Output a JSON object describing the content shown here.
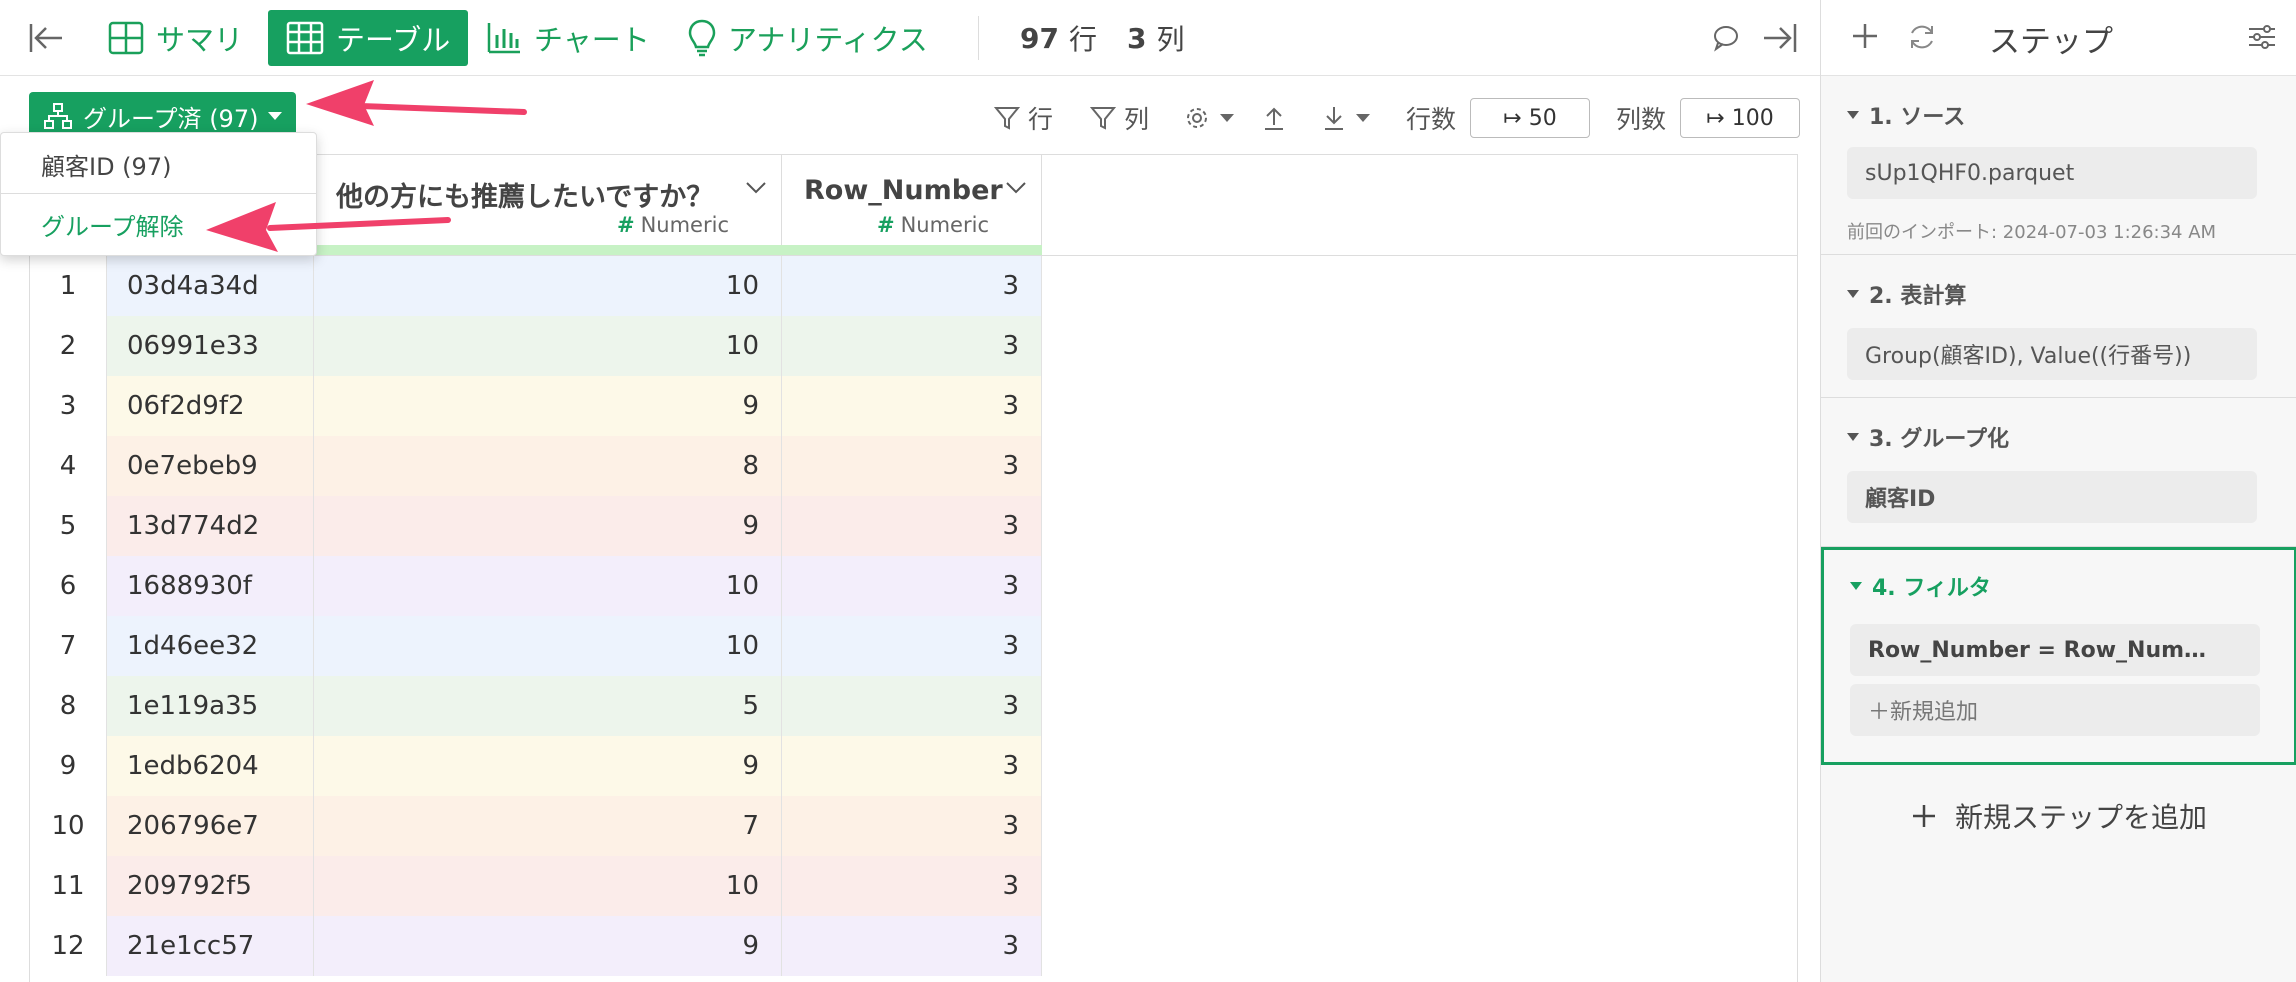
{
  "toolbar": {
    "tabs": [
      {
        "label": "サマリ",
        "icon": "summary-grid-icon"
      },
      {
        "label": "テーブル",
        "icon": "table-icon",
        "active": true
      },
      {
        "label": "チャート",
        "icon": "bar-chart-icon"
      },
      {
        "label": "アナリティクス",
        "icon": "lightbulb-icon"
      }
    ],
    "rows_count": "97",
    "rows_unit": "行",
    "cols_count": "3",
    "cols_unit": "列"
  },
  "subtoolbar": {
    "group_button": "グループ済 (97)",
    "filter_row": "行",
    "filter_col": "列",
    "rows_label": "行数",
    "rows_value": "↦ 50",
    "cols_label": "列数",
    "cols_value": "↦ 100"
  },
  "dropdown": {
    "items": [
      "顧客ID (97)",
      "グループ解除"
    ]
  },
  "columns": [
    {
      "title": "他の方にも推薦したいですか？",
      "type": "Numeric"
    },
    {
      "title": "Row_Number",
      "type": "Numeric"
    }
  ],
  "rows": [
    {
      "n": "1",
      "id": "03d4a34d",
      "rec": "10",
      "rn": "3",
      "color": "#edf3fd"
    },
    {
      "n": "2",
      "id": "06991e33",
      "rec": "10",
      "rn": "3",
      "color": "#edf5ec"
    },
    {
      "n": "3",
      "id": "06f2d9f2",
      "rec": "9",
      "rn": "3",
      "color": "#fdf9e8"
    },
    {
      "n": "4",
      "id": "0e7ebeb9",
      "rec": "8",
      "rn": "3",
      "color": "#fdf1e6"
    },
    {
      "n": "5",
      "id": "13d774d2",
      "rec": "9",
      "rn": "3",
      "color": "#fbecea"
    },
    {
      "n": "6",
      "id": "1688930f",
      "rec": "10",
      "rn": "3",
      "color": "#f3eefb"
    },
    {
      "n": "7",
      "id": "1d46ee32",
      "rec": "10",
      "rn": "3",
      "color": "#edf3fd"
    },
    {
      "n": "8",
      "id": "1e119a35",
      "rec": "5",
      "rn": "3",
      "color": "#edf5ec"
    },
    {
      "n": "9",
      "id": "1edb6204",
      "rec": "9",
      "rn": "3",
      "color": "#fdf9e8"
    },
    {
      "n": "10",
      "id": "206796e7",
      "rec": "7",
      "rn": "3",
      "color": "#fdf1e6"
    },
    {
      "n": "11",
      "id": "209792f5",
      "rec": "10",
      "rn": "3",
      "color": "#fbecea"
    },
    {
      "n": "12",
      "id": "21e1cc57",
      "rec": "9",
      "rn": "3",
      "color": "#f3eefb"
    }
  ],
  "steps_panel": {
    "title": "ステップ",
    "steps": [
      {
        "header": "1. ソース",
        "box": "sUp1QHF0.parquet",
        "sub": "前回のインポート: 2024-07-03 1:26:34 AM"
      },
      {
        "header": "2. 表計算",
        "box": "Group(顧客ID), Value((行番号))"
      },
      {
        "header": "3. グループ化",
        "box": "顧客ID"
      },
      {
        "header": "4. フィルタ",
        "box": "Row_Number = Row_Num…",
        "add": "＋新規追加"
      }
    ],
    "add_step": "新規ステップを追加"
  },
  "colors": {
    "accent": "#17a060",
    "arrow": "#f0406a"
  }
}
